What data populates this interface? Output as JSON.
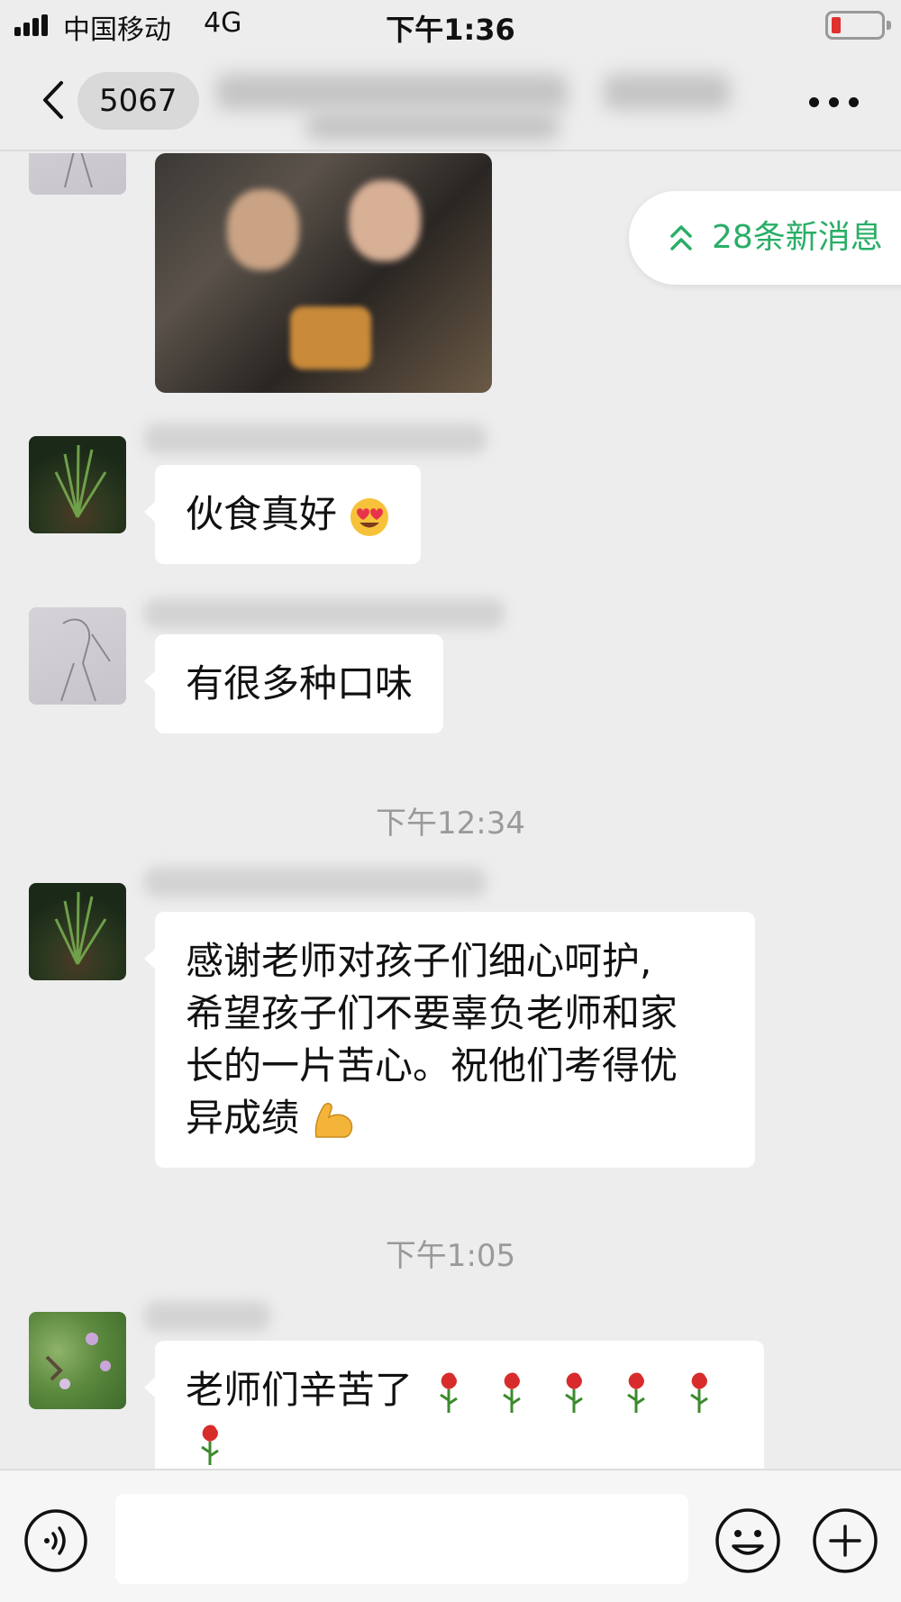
{
  "status_bar": {
    "carrier": "中国移动",
    "network": "4G",
    "time": "下午1:36",
    "battery_level": 0.15
  },
  "header": {
    "unread_count": "5067"
  },
  "new_messages_banner": {
    "label": "28条新消息",
    "color": "#2aae67"
  },
  "messages": [
    {
      "type": "image"
    },
    {
      "type": "text",
      "text": "伙食真好",
      "emoji": "heart-eyes-emoji"
    },
    {
      "type": "text",
      "text": "有很多种口味"
    },
    {
      "type": "time",
      "text": "下午12:34"
    },
    {
      "type": "text",
      "lines": [
        "感谢老师对孩子们细心呵护,",
        "希望孩子们不要辜负老师和家",
        "长的一片苦心。祝他们考得优",
        "异成绩"
      ],
      "emoji": "flexed-biceps-emoji"
    },
    {
      "type": "time",
      "text": "下午1:05"
    },
    {
      "type": "text",
      "text": "老师们辛苦了",
      "emoji": "rose-emoji",
      "emoji_count": 6
    }
  ],
  "icons": {
    "back": "chevron-left-icon",
    "more": "more-dots-icon",
    "voice": "voice-icon",
    "emoji": "emoji-icon",
    "plus": "plus-icon"
  }
}
